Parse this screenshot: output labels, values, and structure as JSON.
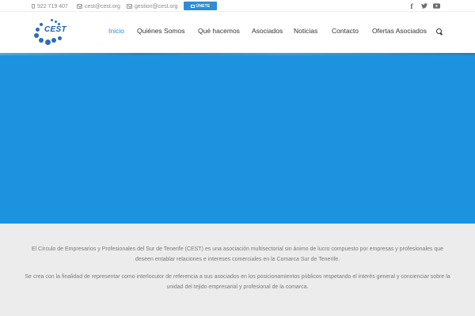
{
  "topbar": {
    "phone": "922 719 407",
    "email_1": "cest@cest.org",
    "email_2": "gestion@cest.org",
    "join_label": "ÚNETE"
  },
  "social": {
    "facebook_glyph": "f",
    "icons": [
      "facebook-icon",
      "twitter-icon",
      "youtube-icon"
    ]
  },
  "logo": {
    "text": "CEST",
    "color": "#1e5fa8"
  },
  "nav": {
    "items": [
      {
        "label": "Inicio",
        "active": true
      },
      {
        "label": "Quiénes Somos",
        "active": false
      },
      {
        "label": "Qué hacemos",
        "active": false
      },
      {
        "label": "Asociados",
        "active": false
      },
      {
        "label": "Noticias",
        "active": false
      },
      {
        "label": "Contacto",
        "active": false
      },
      {
        "label": "Ofertas Asociados",
        "active": false
      }
    ]
  },
  "colors": {
    "accent": "#2c8fd6",
    "hero": "#1d93e0",
    "background": "#ececec"
  },
  "intro": {
    "paragraph_1": "El Círculo de Empresarios y Profesionales del Sur de Tenerife (CEST) es una asociación multisectorial sin ánimo de lucro compuesto por empresas y profesionales que deseen entablar relaciones e intereses comerciales en la Comarca Sur de Tenerife.",
    "paragraph_2": "Se crea con la finalidad de representar como interlocutor de referencia a sus asociados en los posicionamientos públicos respetando el interés general y concienciar sobre la unidad del tejido empresarial y profesional de la comarca."
  }
}
